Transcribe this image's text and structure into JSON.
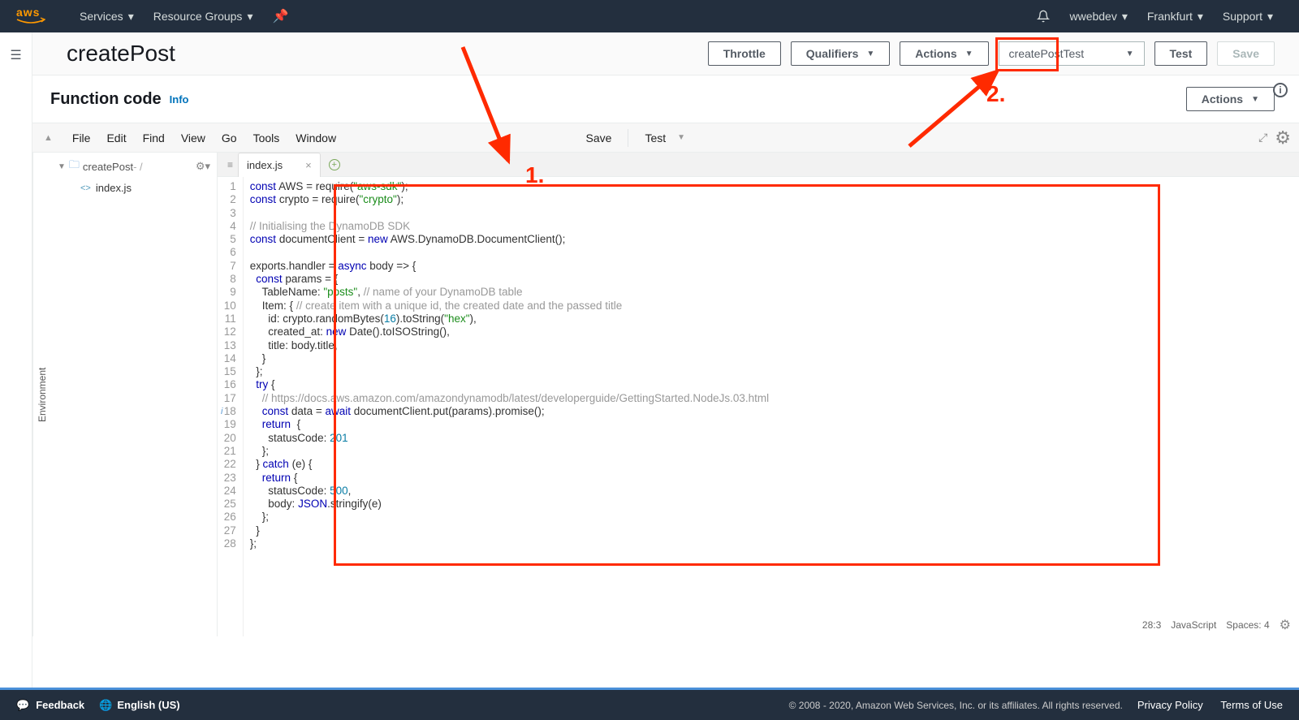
{
  "topnav": {
    "logo_text": "aws",
    "services": "Services",
    "resource_groups": "Resource Groups",
    "user": "wwebdev",
    "region": "Frankfurt",
    "support": "Support"
  },
  "header": {
    "title": "createPost",
    "throttle": "Throttle",
    "qualifiers": "Qualifiers",
    "actions": "Actions",
    "test_event": "createPostTest",
    "test": "Test",
    "save": "Save"
  },
  "panel": {
    "title": "Function code",
    "info": "Info",
    "actions": "Actions"
  },
  "editor": {
    "menubar": [
      "File",
      "Edit",
      "Find",
      "View",
      "Go",
      "Tools",
      "Window"
    ],
    "save": "Save",
    "test": "Test",
    "env_tab": "Environment",
    "tree_root": "createPost",
    "tree_file": "index.js",
    "tab_name": "index.js",
    "status_pos": "28:3",
    "status_lang": "JavaScript",
    "status_spaces": "Spaces: 4",
    "code_lines": [
      {
        "n": 1,
        "t": "const AWS = require(\"aws-sdk\");",
        "k": [
          "const"
        ],
        "s": [
          "\"aws-sdk\""
        ]
      },
      {
        "n": 2,
        "t": "const crypto = require(\"crypto\");",
        "k": [
          "const"
        ],
        "s": [
          "\"crypto\""
        ]
      },
      {
        "n": 3,
        "t": ""
      },
      {
        "n": 4,
        "t": "// Initialising the DynamoDB SDK",
        "cm": true
      },
      {
        "n": 5,
        "t": "const documentClient = new AWS.DynamoDB.DocumentClient();",
        "k": [
          "const",
          "new"
        ]
      },
      {
        "n": 6,
        "t": ""
      },
      {
        "n": 7,
        "t": "exports.handler = async body => {",
        "k": [
          "async"
        ]
      },
      {
        "n": 8,
        "t": "  const params = {",
        "k": [
          "const"
        ]
      },
      {
        "n": 9,
        "t": "    TableName: \"posts\", // name of your DynamoDB table",
        "s": [
          "\"posts\""
        ],
        "tc": "// name of your DynamoDB table"
      },
      {
        "n": 10,
        "t": "    Item: { // create item with a unique id, the created date and the passed title",
        "tc": "// create item with a unique id, the created date and the passed title"
      },
      {
        "n": 11,
        "t": "      id: crypto.randomBytes(16).toString(\"hex\"),",
        "s": [
          "\"hex\""
        ],
        "nums": [
          "16"
        ]
      },
      {
        "n": 12,
        "t": "      created_at: new Date().toISOString(),",
        "k": [
          "new"
        ]
      },
      {
        "n": 13,
        "t": "      title: body.title,"
      },
      {
        "n": 14,
        "t": "    }"
      },
      {
        "n": 15,
        "t": "  };"
      },
      {
        "n": 16,
        "t": "  try {",
        "k": [
          "try"
        ]
      },
      {
        "n": 17,
        "t": "    // https://docs.aws.amazon.com/amazondynamodb/latest/developerguide/GettingStarted.NodeJs.03.html",
        "cm": true
      },
      {
        "n": 18,
        "t": "    const data = await documentClient.put(params).promise();",
        "k": [
          "const",
          "await"
        ],
        "info": true
      },
      {
        "n": 19,
        "t": "    return  {",
        "k": [
          "return"
        ]
      },
      {
        "n": 20,
        "t": "      statusCode: 201",
        "nums": [
          "201"
        ]
      },
      {
        "n": 21,
        "t": "    };"
      },
      {
        "n": 22,
        "t": "  } catch (e) {",
        "k": [
          "catch"
        ]
      },
      {
        "n": 23,
        "t": "    return {",
        "k": [
          "return"
        ]
      },
      {
        "n": 24,
        "t": "      statusCode: 500,",
        "nums": [
          "500"
        ]
      },
      {
        "n": 25,
        "t": "      body: JSON.stringify(e)",
        "k": [
          "JSON"
        ]
      },
      {
        "n": 26,
        "t": "    };"
      },
      {
        "n": 27,
        "t": "  }"
      },
      {
        "n": 28,
        "t": "};",
        "hl": true
      }
    ]
  },
  "annotations": {
    "one": "1.",
    "two": "2."
  },
  "footer": {
    "feedback": "Feedback",
    "language": "English (US)",
    "copyright": "© 2008 - 2020, Amazon Web Services, Inc. or its affiliates. All rights reserved.",
    "privacy": "Privacy Policy",
    "terms": "Terms of Use"
  }
}
